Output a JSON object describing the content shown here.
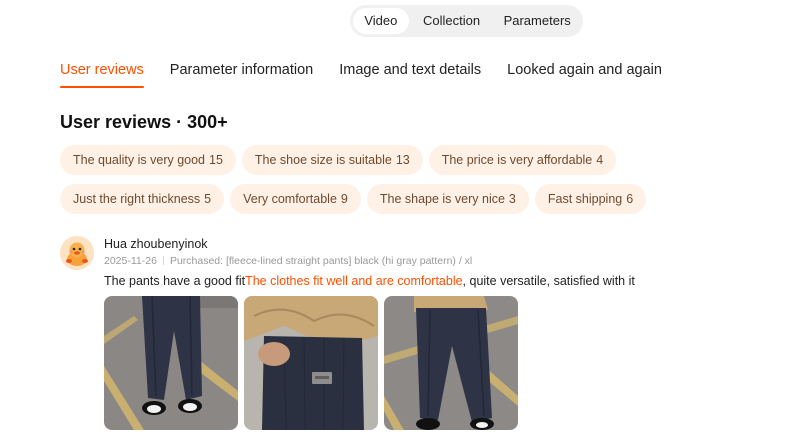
{
  "media_tabs": [
    {
      "label": "Video",
      "active": true
    },
    {
      "label": "Collection",
      "active": false
    },
    {
      "label": "Parameters",
      "active": false
    }
  ],
  "nav": [
    {
      "label": "User reviews",
      "active": true
    },
    {
      "label": "Parameter information",
      "active": false
    },
    {
      "label": "Image and text details",
      "active": false
    },
    {
      "label": "Looked again and again",
      "active": false
    }
  ],
  "reviews_section": {
    "title": "User reviews",
    "separator": "·",
    "count": "300+"
  },
  "tags": [
    {
      "label": "The quality is very good",
      "count": "15"
    },
    {
      "label": "The shoe size is suitable",
      "count": "13"
    },
    {
      "label": "The price is very affordable",
      "count": "4"
    },
    {
      "label": "Just the right thickness",
      "count": "5"
    },
    {
      "label": "Very comfortable",
      "count": "9"
    },
    {
      "label": "The shape is very nice",
      "count": "3"
    },
    {
      "label": "Fast shipping",
      "count": "6"
    }
  ],
  "review": {
    "username": "Hua zhoubenyinok",
    "date": "2025-11-26",
    "purchased": "Purchased: [fleece-lined straight pants] black (hi gray pattern) / xl",
    "text_before": "The pants have a good fit",
    "text_highlight": "The clothes fit well and are comfortable",
    "text_after": ", quite versatile, satisfied with it",
    "avatar_icon": "duck-avatar-icon",
    "photos": [
      "pants-photo-front",
      "pants-photo-pocket-closeup",
      "pants-photo-side"
    ]
  },
  "colors": {
    "accent": "#ff5000",
    "tag_bg": "#fff1e6",
    "tag_text": "#6e4a2e",
    "pill_bg": "#f0f0f0",
    "meta_text": "#999999"
  }
}
